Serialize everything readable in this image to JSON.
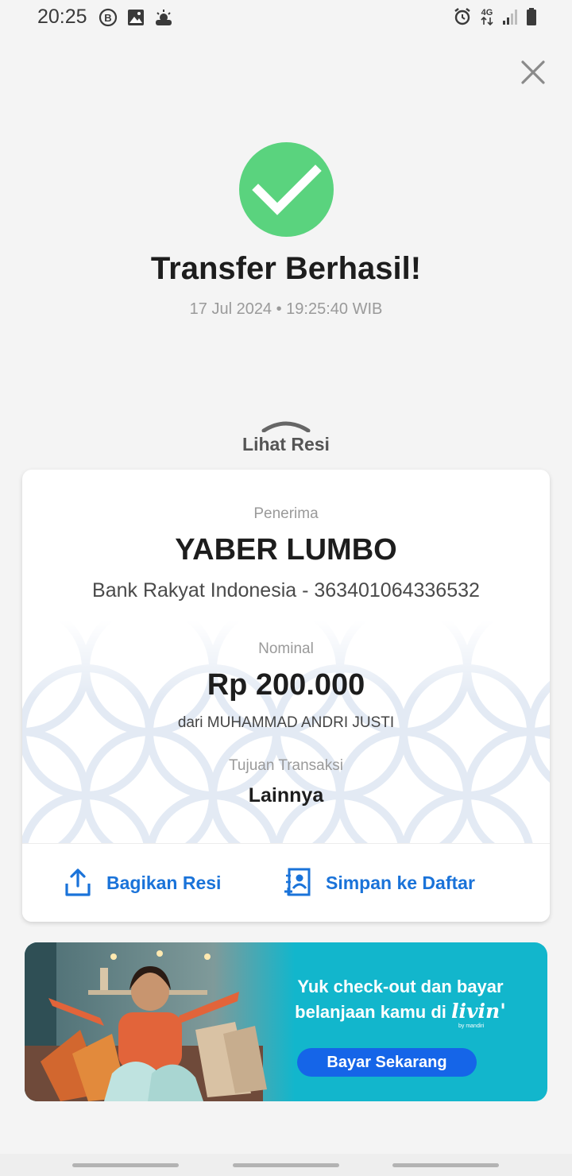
{
  "status_bar": {
    "time": "20:25",
    "network": "4G",
    "icons_left": [
      "b-notification-icon",
      "image-icon",
      "weather-icon"
    ],
    "icons_right": [
      "alarm-icon",
      "network-4g-icon",
      "signal-icon",
      "battery-icon"
    ]
  },
  "colors": {
    "success": "#5ad37e",
    "accent_blue": "#1a73d9",
    "banner_bg": "#12b6cc",
    "banner_button": "#1565e8"
  },
  "header": {
    "title": "Transfer Berhasil!",
    "datetime": "17 Jul 2024 • 19:25:40 WIB"
  },
  "receipt_toggle": {
    "label": "Lihat Resi"
  },
  "receipt": {
    "recipient_label": "Penerima",
    "recipient_name": "YABER LUMBO",
    "recipient_bank": "Bank Rakyat Indonesia - 363401064336532",
    "amount_label": "Nominal",
    "amount": "Rp 200.000",
    "sender": "dari MUHAMMAD ANDRI JUSTI",
    "purpose_label": "Tujuan Transaksi",
    "purpose": "Lainnya"
  },
  "actions": {
    "share": "Bagikan Resi",
    "save": "Simpan ke Daftar"
  },
  "banner": {
    "line1": "Yuk check-out dan bayar",
    "line2_prefix": "belanjaan kamu di",
    "brand": "livin'",
    "brand_sub": "by mandiri",
    "button": "Bayar Sekarang"
  }
}
